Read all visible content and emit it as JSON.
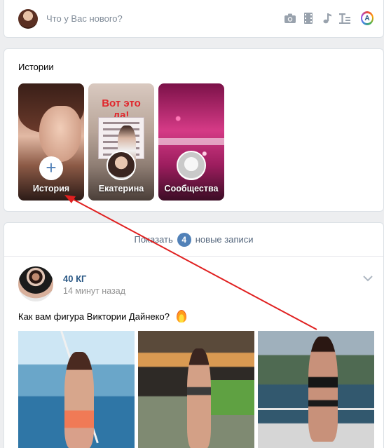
{
  "composer": {
    "placeholder": "Что у Вас нового?",
    "tools": [
      "camera-icon",
      "film-icon",
      "music-icon",
      "text-format-icon",
      "apps-icon"
    ],
    "apps_letter": "A"
  },
  "stories": {
    "title": "Истории",
    "items": [
      {
        "label": "История"
      },
      {
        "label": "Екатерина",
        "headline": "Вот это да!"
      },
      {
        "label": "Сообщества"
      }
    ]
  },
  "feed": {
    "show_prefix": "Показать",
    "show_count": "4",
    "show_suffix": "новые записи",
    "post": {
      "author": "40 КГ",
      "time": "14 минут назад",
      "text": "Как вам фигура Виктории Дайнеко?"
    }
  },
  "colors": {
    "link": "#2a5885",
    "accent": "#5181b8",
    "annotation": "#e02020"
  }
}
